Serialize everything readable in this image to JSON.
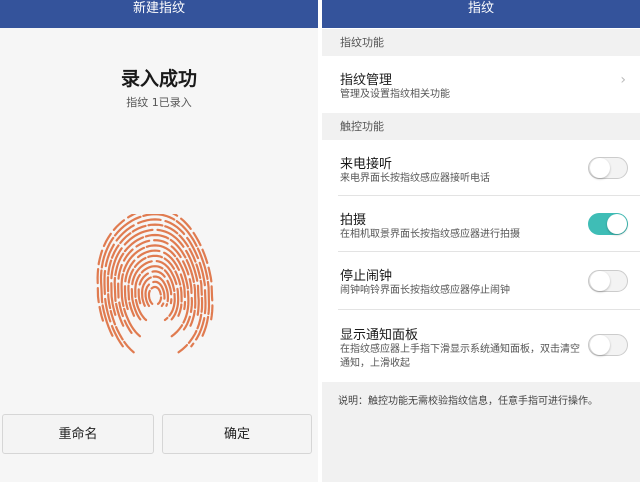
{
  "colors": {
    "header_bg": "#34539b",
    "toggle_on": "#3fbdb6",
    "fingerprint": "#e07b50"
  },
  "left": {
    "title": "新建指纹",
    "success_title": "录入成功",
    "success_sub": "指纹 1已录入",
    "fingerprint_icon": "fingerprint-icon",
    "rename_label": "重命名",
    "ok_label": "确定"
  },
  "right": {
    "title": "指纹",
    "section1": "指纹功能",
    "manage": {
      "title": "指纹管理",
      "sub": "管理及设置指纹相关功能",
      "icon": "chevron-right-icon"
    },
    "section2": "触控功能",
    "items": [
      {
        "title": "来电接听",
        "sub": "来电界面长按指纹感应器接听电话",
        "on": false
      },
      {
        "title": "拍摄",
        "sub": "在相机取景界面长按指纹感应器进行拍摄",
        "on": true
      },
      {
        "title": "停止闹钟",
        "sub": "闹钟响铃界面长按指纹感应器停止闹钟",
        "on": false
      },
      {
        "title": "显示通知面板",
        "sub_line1": "在指纹感应器上手指下滑显示系统通知面板，双击清空",
        "sub_line2": "通知，上滑收起",
        "on": false
      }
    ],
    "note": "说明：触控功能无需校验指纹信息，任意手指可进行操作。"
  }
}
